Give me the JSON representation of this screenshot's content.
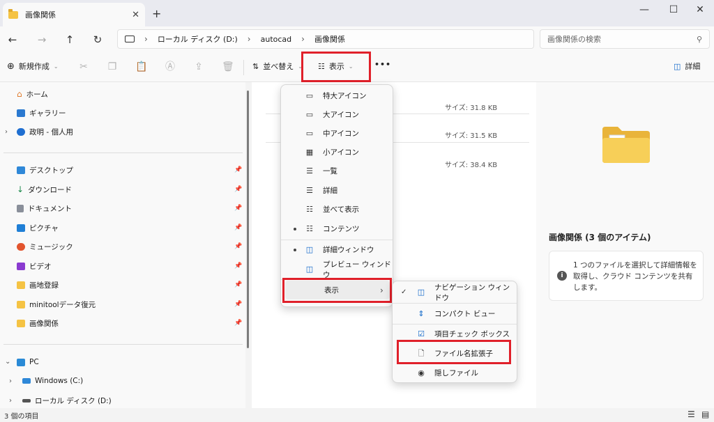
{
  "window": {
    "tab_title": "画像関係",
    "tab_close": "✕",
    "new_tab": "+",
    "minimize": "—",
    "maximize": "☐",
    "close": "✕"
  },
  "nav": {
    "back": "←",
    "forward": "→",
    "up": "↑",
    "refresh": "↻",
    "breadcrumb": [
      "ローカル ディスク (D:)",
      "autocad",
      "画像関係"
    ],
    "search_placeholder": "画像関係の検索"
  },
  "toolbar": {
    "new_label": "新規作成",
    "sort_label": "並べ替え",
    "view_label": "表示",
    "more": "•••",
    "details_label": "詳細"
  },
  "sidebar": {
    "top": [
      {
        "label": "ホーム",
        "icon": "home-icon"
      },
      {
        "label": "ギャラリー",
        "icon": "gallery-icon"
      },
      {
        "label": "政明 - 個人用",
        "icon": "cloud-icon"
      }
    ],
    "quick": [
      {
        "label": "デスクトップ",
        "icon": "desktop-icon"
      },
      {
        "label": "ダウンロード",
        "icon": "download-icon"
      },
      {
        "label": "ドキュメント",
        "icon": "document-icon"
      },
      {
        "label": "ピクチャ",
        "icon": "pictures-icon"
      },
      {
        "label": "ミュージック",
        "icon": "music-icon"
      },
      {
        "label": "ビデオ",
        "icon": "video-icon"
      },
      {
        "label": "画地登録",
        "icon": "folder-icon"
      },
      {
        "label": "minitoolデータ復元",
        "icon": "folder-icon"
      },
      {
        "label": "画像関係",
        "icon": "folder-icon"
      }
    ],
    "pc": {
      "label": "PC"
    },
    "drives": [
      {
        "label": "Windows (C:)"
      },
      {
        "label": "ローカル ディスク (D:)"
      }
    ]
  },
  "files": [
    {
      "size": "サイズ: 31.8 KB"
    },
    {
      "size": "サイズ: 31.5 KB"
    },
    {
      "size": "サイズ: 38.4 KB"
    }
  ],
  "view_menu": {
    "items": [
      {
        "label": "特大アイコン",
        "icon": "extra-large-icons-icon",
        "glyph": "▭",
        "selected": false
      },
      {
        "label": "大アイコン",
        "icon": "large-icons-icon",
        "glyph": "▭",
        "selected": false
      },
      {
        "label": "中アイコン",
        "icon": "medium-icons-icon",
        "glyph": "▭",
        "selected": false
      },
      {
        "label": "小アイコン",
        "icon": "small-icons-icon",
        "glyph": "▦",
        "selected": false
      },
      {
        "label": "一覧",
        "icon": "list-icon",
        "glyph": "☰",
        "selected": false
      },
      {
        "label": "詳細",
        "icon": "details-view-icon",
        "glyph": "☰",
        "selected": false
      },
      {
        "label": "並べて表示",
        "icon": "tiles-icon",
        "glyph": "☷",
        "selected": false
      },
      {
        "label": "コンテンツ",
        "icon": "content-icon",
        "glyph": "☷",
        "selected": true
      }
    ],
    "panes": [
      {
        "label": "詳細ウィンドウ",
        "icon": "details-pane-icon",
        "glyph": "◫",
        "selected": true
      },
      {
        "label": "プレビュー ウィンドウ",
        "icon": "preview-pane-icon",
        "glyph": "◫",
        "selected": false
      }
    ],
    "show": {
      "label": "表示",
      "arrow": "›"
    }
  },
  "show_submenu": {
    "items": [
      {
        "label": "ナビゲーション ウィンドウ",
        "icon": "navigation-pane-icon",
        "glyph": "◫",
        "checked": true
      },
      {
        "label": "コンパクト ビュー",
        "icon": "compact-view-icon",
        "glyph": "⇕",
        "checked": false
      },
      {
        "label": "項目チェック ボックス",
        "icon": "checkbox-icon",
        "glyph": "☑",
        "checked": false
      },
      {
        "label": "ファイル名拡張子",
        "icon": "file-extension-icon",
        "glyph": "🗋",
        "checked": false
      },
      {
        "label": "隠しファイル",
        "icon": "hidden-files-icon",
        "glyph": "◉",
        "checked": false
      }
    ],
    "check": "✓"
  },
  "details_pane": {
    "title": "画像関係 (3 個のアイテム)",
    "info": "1 つのファイルを選択して詳細情報を取得し、クラウド コンテンツを共有します。"
  },
  "status": {
    "count": "3 個の項目"
  },
  "colors": {
    "highlight": "#e0202a",
    "folder": "#f5c344",
    "accent": "#0a64c8"
  }
}
